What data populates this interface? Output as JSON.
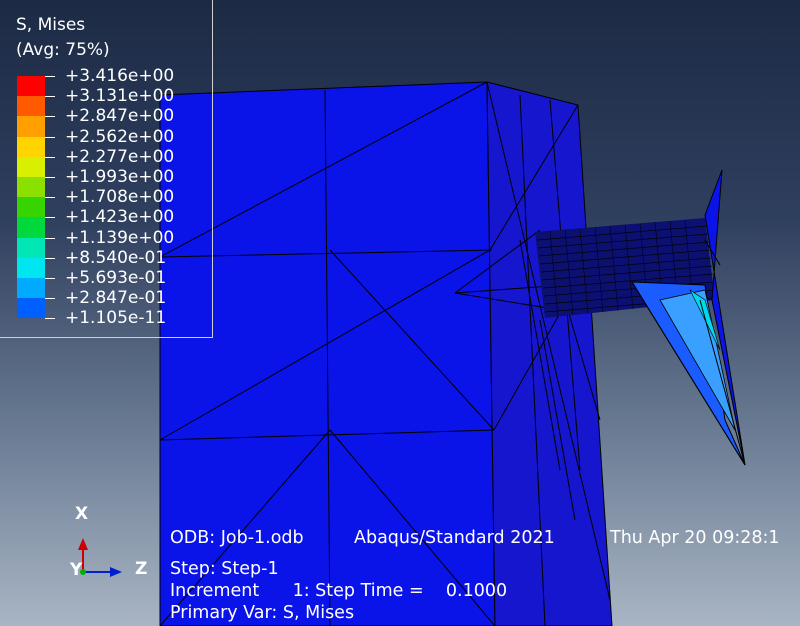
{
  "legend": {
    "title_line1": "S, Mises",
    "title_line2": "(Avg: 75%)",
    "entries": [
      {
        "value": "+3.416e+00",
        "color": "#ff0000"
      },
      {
        "value": "+3.131e+00",
        "color": "#ff5a00"
      },
      {
        "value": "+2.847e+00",
        "color": "#ffa000"
      },
      {
        "value": "+2.562e+00",
        "color": "#ffd400"
      },
      {
        "value": "+2.277e+00",
        "color": "#d8f000"
      },
      {
        "value": "+1.993e+00",
        "color": "#8ce000"
      },
      {
        "value": "+1.708e+00",
        "color": "#38d400"
      },
      {
        "value": "+1.423e+00",
        "color": "#00d83c"
      },
      {
        "value": "+1.139e+00",
        "color": "#00e6b4"
      },
      {
        "value": "+8.540e-01",
        "color": "#00e6f0"
      },
      {
        "value": "+5.693e-01",
        "color": "#00aaff"
      },
      {
        "value": "+2.847e-01",
        "color": "#0060ff"
      },
      {
        "value": "+1.105e-11",
        "color": "#0018ff"
      }
    ]
  },
  "info": {
    "odb": "ODB: Job-1.odb",
    "solver": "Abaqus/Standard 2021",
    "date": "Thu Apr 20 09:28:1",
    "step": "Step: Step-1",
    "increment": "Increment      1: Step Time =    0.1000",
    "primary_var": "Primary Var: S, Mises"
  },
  "triad": {
    "x_label": "X",
    "y_label": "Y",
    "z_label": "Z"
  },
  "colors": {
    "model_blue": "#0a14e8",
    "model_side": "#1a1ad0"
  }
}
